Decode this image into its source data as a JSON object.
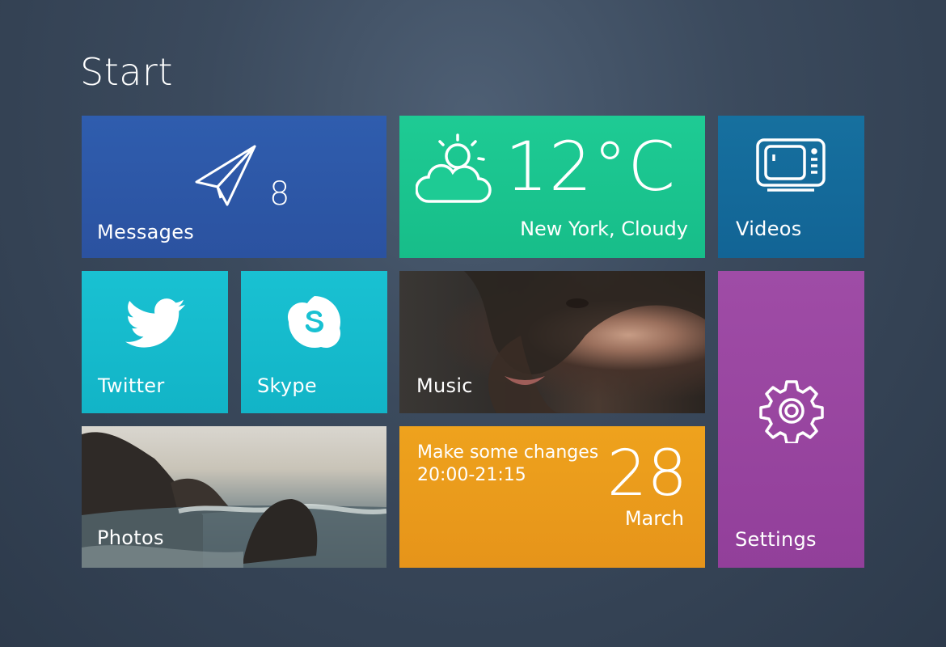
{
  "header": {
    "title": "Start"
  },
  "tiles": {
    "messages": {
      "label": "Messages",
      "count": "8",
      "icon": "paper-plane-icon",
      "color": "#2f5dae"
    },
    "weather": {
      "temperature": "12°C",
      "location": "New York, Cloudy",
      "icon": "partly-cloudy-icon",
      "color": "#1ecb94"
    },
    "videos": {
      "label": "Videos",
      "icon": "tv-icon",
      "color": "#16709f"
    },
    "twitter": {
      "label": "Twitter",
      "icon": "twitter-bird-icon",
      "color": "#19c1d2"
    },
    "skype": {
      "label": "Skype",
      "icon": "skype-icon",
      "color": "#19c1d2"
    },
    "music": {
      "label": "Music"
    },
    "settings": {
      "label": "Settings",
      "icon": "gear-icon",
      "color": "#9f4ca6"
    },
    "photos": {
      "label": "Photos"
    },
    "calendar": {
      "event_title": "Make some changes",
      "event_time": "20:00-21:15",
      "day": "28",
      "month": "March",
      "color": "#eea21d"
    }
  }
}
